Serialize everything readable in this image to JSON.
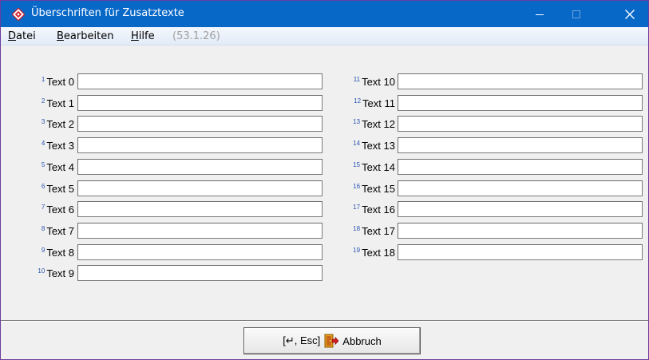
{
  "window": {
    "title": "Überschriften für Zusatztexte",
    "icons": {
      "app": "diamond-logo-icon",
      "minimize": "minimize-icon",
      "maximize": "maximize-icon",
      "close": "close-icon"
    }
  },
  "menu": {
    "datei": {
      "accel": "D",
      "rest": "atei"
    },
    "bearbeiten": {
      "accel": "B",
      "rest": "earbeiten"
    },
    "hilfe": {
      "accel": "H",
      "rest": "ilfe"
    },
    "version": "(53.1.26)"
  },
  "fields_left": [
    {
      "sup": "1",
      "label": "Text 0",
      "value": ""
    },
    {
      "sup": "2",
      "label": "Text 1",
      "value": ""
    },
    {
      "sup": "3",
      "label": "Text 2",
      "value": ""
    },
    {
      "sup": "4",
      "label": "Text 3",
      "value": ""
    },
    {
      "sup": "5",
      "label": "Text 4",
      "value": ""
    },
    {
      "sup": "6",
      "label": "Text 5",
      "value": ""
    },
    {
      "sup": "7",
      "label": "Text 6",
      "value": ""
    },
    {
      "sup": "8",
      "label": "Text 7",
      "value": ""
    },
    {
      "sup": "9",
      "label": "Text 8",
      "value": ""
    },
    {
      "sup": "10",
      "label": "Text 9",
      "value": ""
    }
  ],
  "fields_right": [
    {
      "sup": "11",
      "label": "Text 10",
      "value": ""
    },
    {
      "sup": "12",
      "label": "Text 11",
      "value": ""
    },
    {
      "sup": "13",
      "label": "Text 12",
      "value": ""
    },
    {
      "sup": "14",
      "label": "Text 13",
      "value": ""
    },
    {
      "sup": "15",
      "label": "Text 14",
      "value": ""
    },
    {
      "sup": "16",
      "label": "Text 15",
      "value": ""
    },
    {
      "sup": "17",
      "label": "Text 16",
      "value": ""
    },
    {
      "sup": "18",
      "label": "Text 17",
      "value": ""
    },
    {
      "sup": "19",
      "label": "Text 18",
      "value": ""
    }
  ],
  "cancel_button": {
    "keys": "[↵, Esc]",
    "label": "Abbruch",
    "icon": "exit-door-icon"
  },
  "colors": {
    "titlebar": "#0868c8",
    "superscript": "#2a55b0",
    "version_text": "#a0a0a0"
  }
}
